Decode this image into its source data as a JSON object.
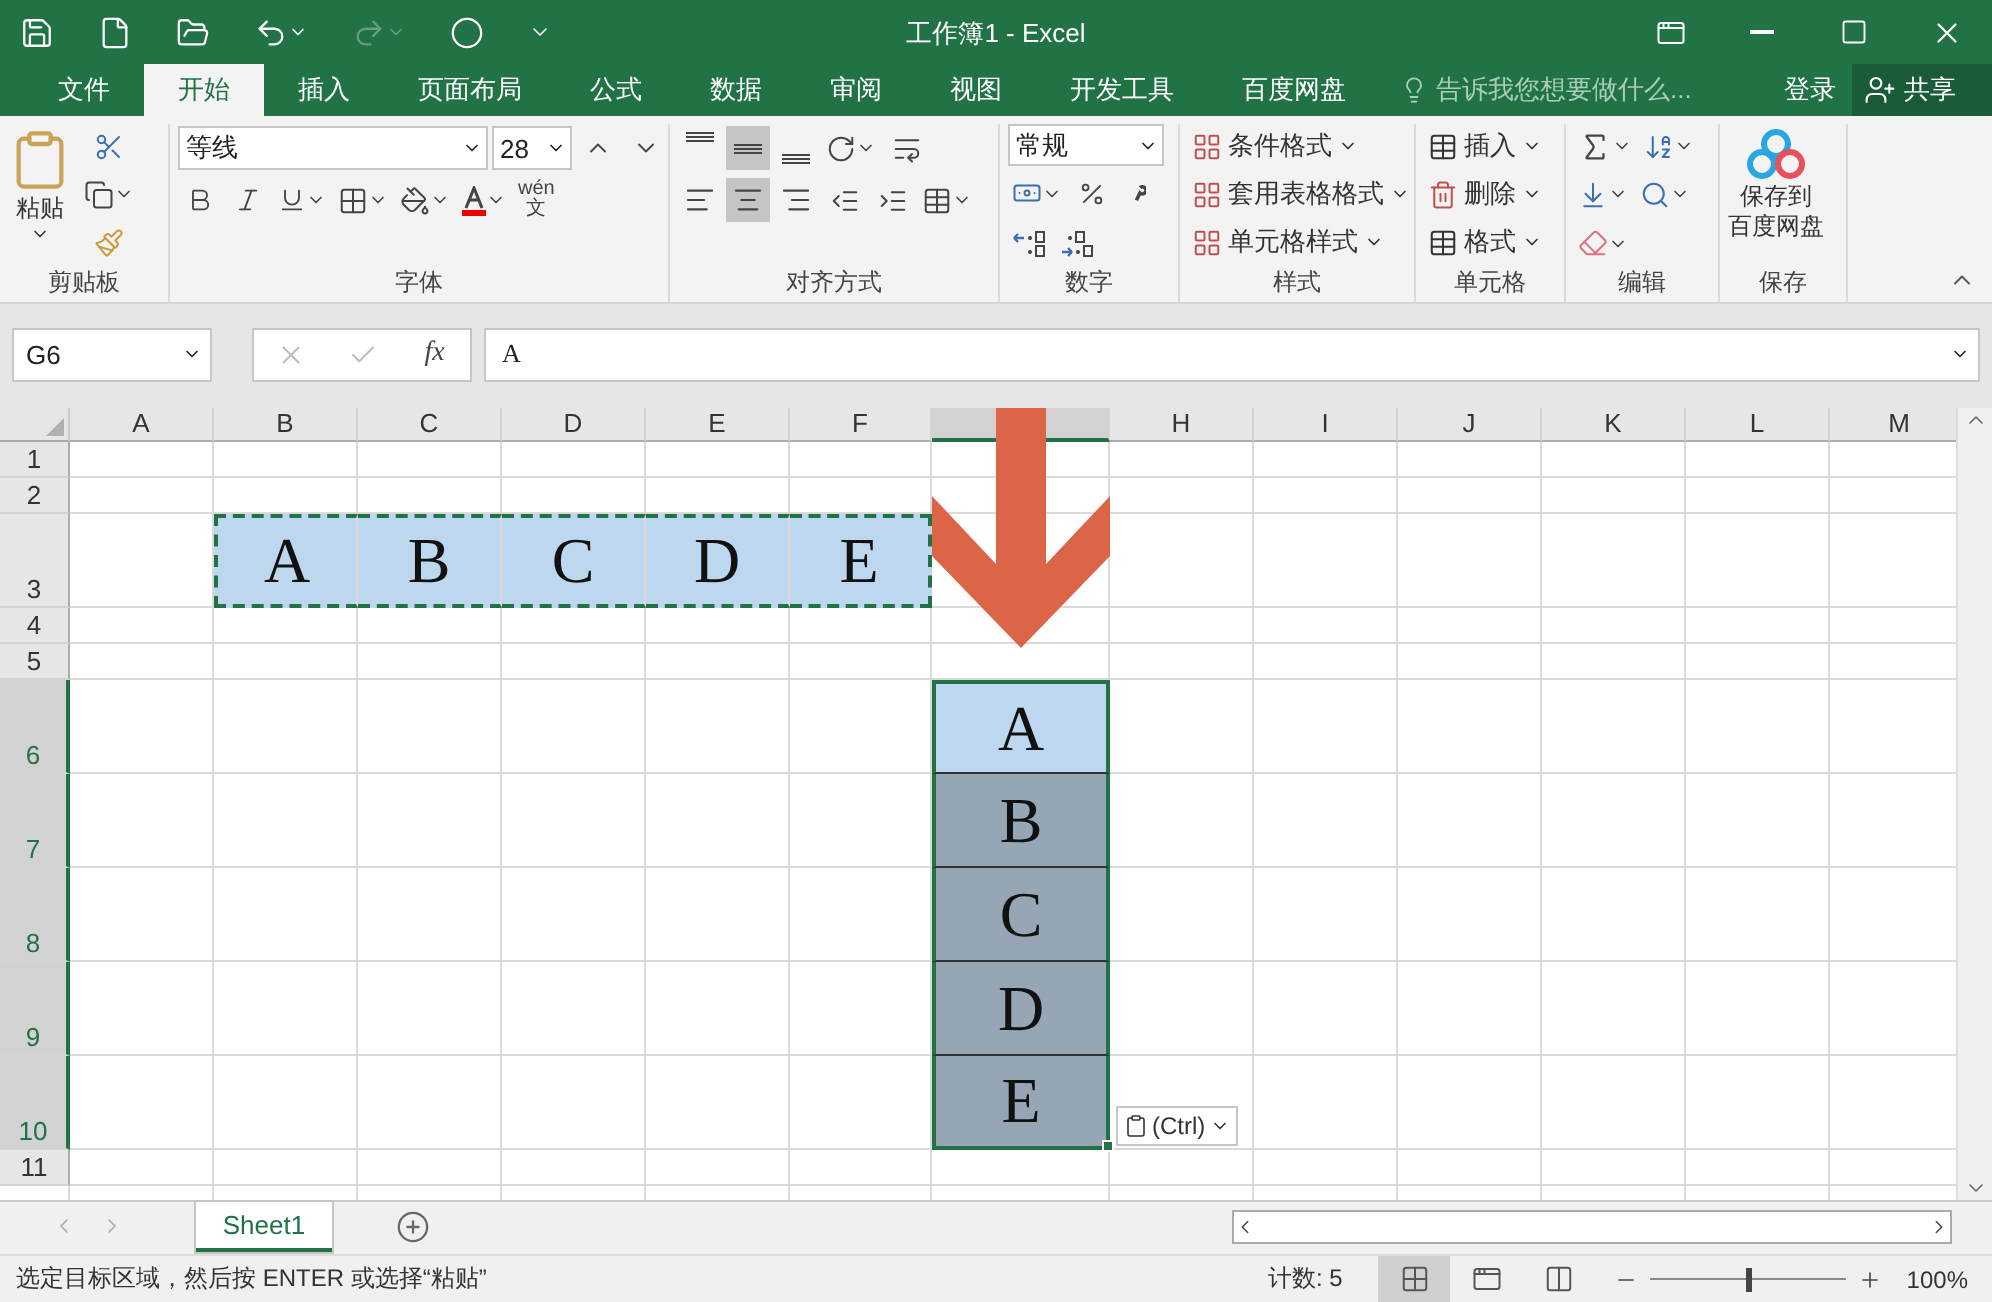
{
  "window": {
    "title": "工作簿1 - Excel"
  },
  "menu_tabs": [
    {
      "label": "文件",
      "selected": false
    },
    {
      "label": "开始",
      "selected": true
    },
    {
      "label": "插入",
      "selected": false
    },
    {
      "label": "页面布局",
      "selected": false
    },
    {
      "label": "公式",
      "selected": false
    },
    {
      "label": "数据",
      "selected": false
    },
    {
      "label": "审阅",
      "selected": false
    },
    {
      "label": "视图",
      "selected": false
    },
    {
      "label": "开发工具",
      "selected": false
    },
    {
      "label": "百度网盘",
      "selected": false
    }
  ],
  "tell_me": {
    "placeholder": "告诉我您想要做什么..."
  },
  "account": {
    "sign_in": "登录",
    "share": "共享"
  },
  "ribbon": {
    "clipboard": {
      "paste": "粘贴",
      "label": "剪贴板"
    },
    "font": {
      "name": "等线",
      "size": "28",
      "phonetic_top": "wén",
      "phonetic_bottom": "文",
      "label": "字体"
    },
    "alignment": {
      "vertical": [
        {
          "kind": "top",
          "pressed": false
        },
        {
          "kind": "middle",
          "pressed": true
        },
        {
          "kind": "bottom",
          "pressed": false
        }
      ],
      "horizontal": [
        {
          "kind": "left",
          "pressed": false
        },
        {
          "kind": "center",
          "pressed": true
        },
        {
          "kind": "right",
          "pressed": false
        }
      ],
      "label": "对齐方式"
    },
    "number": {
      "format": "常规",
      "label": "数字"
    },
    "styles": {
      "items": [
        "条件格式",
        "套用表格格式",
        "单元格样式"
      ],
      "label": "样式"
    },
    "cells": {
      "items": [
        "插入",
        "删除",
        "格式"
      ],
      "label": "单元格"
    },
    "editing": {
      "label": "编辑"
    },
    "save": {
      "button": [
        "保存到",
        "百度网盘"
      ],
      "label": "保存"
    }
  },
  "formula_bar": {
    "name_box": "G6",
    "insert_function": "fx",
    "value": "A"
  },
  "columns": [
    {
      "label": "A",
      "selected": false
    },
    {
      "label": "B",
      "selected": false
    },
    {
      "label": "C",
      "selected": false
    },
    {
      "label": "D",
      "selected": false
    },
    {
      "label": "E",
      "selected": false
    },
    {
      "label": "F",
      "selected": false
    },
    {
      "selected": true
    },
    {
      "label": "H",
      "selected": false
    },
    {
      "label": "I",
      "selected": false
    },
    {
      "label": "J",
      "selected": false
    },
    {
      "label": "K",
      "selected": false
    },
    {
      "label": "L",
      "selected": false
    },
    {
      "label": "M",
      "selected": false
    }
  ],
  "rows": [
    {
      "label": "1",
      "selected": false
    },
    {
      "label": "2",
      "selected": false
    },
    {
      "label": "3",
      "selected": false,
      "cells": [
        {},
        {
          "text": "A",
          "copied": true,
          "selected": false
        },
        {
          "text": "B",
          "copied": true,
          "selected": false
        },
        {
          "text": "C",
          "copied": true,
          "selected": false
        },
        {
          "text": "D",
          "copied": true,
          "selected": false
        },
        {
          "text": "E",
          "copied": true,
          "selected": false
        }
      ]
    },
    {
      "label": "4",
      "selected": false
    },
    {
      "label": "5",
      "selected": false
    },
    {
      "label": "6",
      "selected": true,
      "cells": [
        {},
        {},
        {},
        {},
        {},
        {},
        {
          "text": "A",
          "selected": true,
          "active": true
        }
      ]
    },
    {
      "label": "7",
      "selected": true,
      "cells": [
        {},
        {},
        {},
        {},
        {},
        {},
        {
          "text": "B",
          "selected": true,
          "active": false
        }
      ]
    },
    {
      "label": "8",
      "selected": true,
      "cells": [
        {},
        {},
        {},
        {},
        {},
        {},
        {
          "text": "C",
          "selected": true,
          "active": false
        }
      ]
    },
    {
      "label": "9",
      "selected": true,
      "cells": [
        {},
        {},
        {},
        {},
        {},
        {},
        {
          "text": "D",
          "selected": true,
          "active": false
        }
      ]
    },
    {
      "label": "10",
      "selected": true,
      "cells": [
        {},
        {},
        {},
        {},
        {},
        {},
        {
          "text": "E",
          "selected": true,
          "active": false
        }
      ]
    },
    {
      "label": "11",
      "selected": false
    }
  ],
  "paste_options": {
    "label": "(Ctrl)"
  },
  "sheet_tabs": [
    {
      "label": "Sheet1",
      "selected": true
    }
  ],
  "status_bar": {
    "message": "选定目标区域，然后按 ENTER 或选择“粘贴”",
    "count": "计数: 5",
    "views": [
      {
        "kind": "normal",
        "selected": true
      },
      {
        "kind": "page_layout",
        "selected": false
      },
      {
        "kind": "page_break",
        "selected": false
      }
    ],
    "zoom": {
      "level": 0.5,
      "reading": "100%"
    }
  }
}
